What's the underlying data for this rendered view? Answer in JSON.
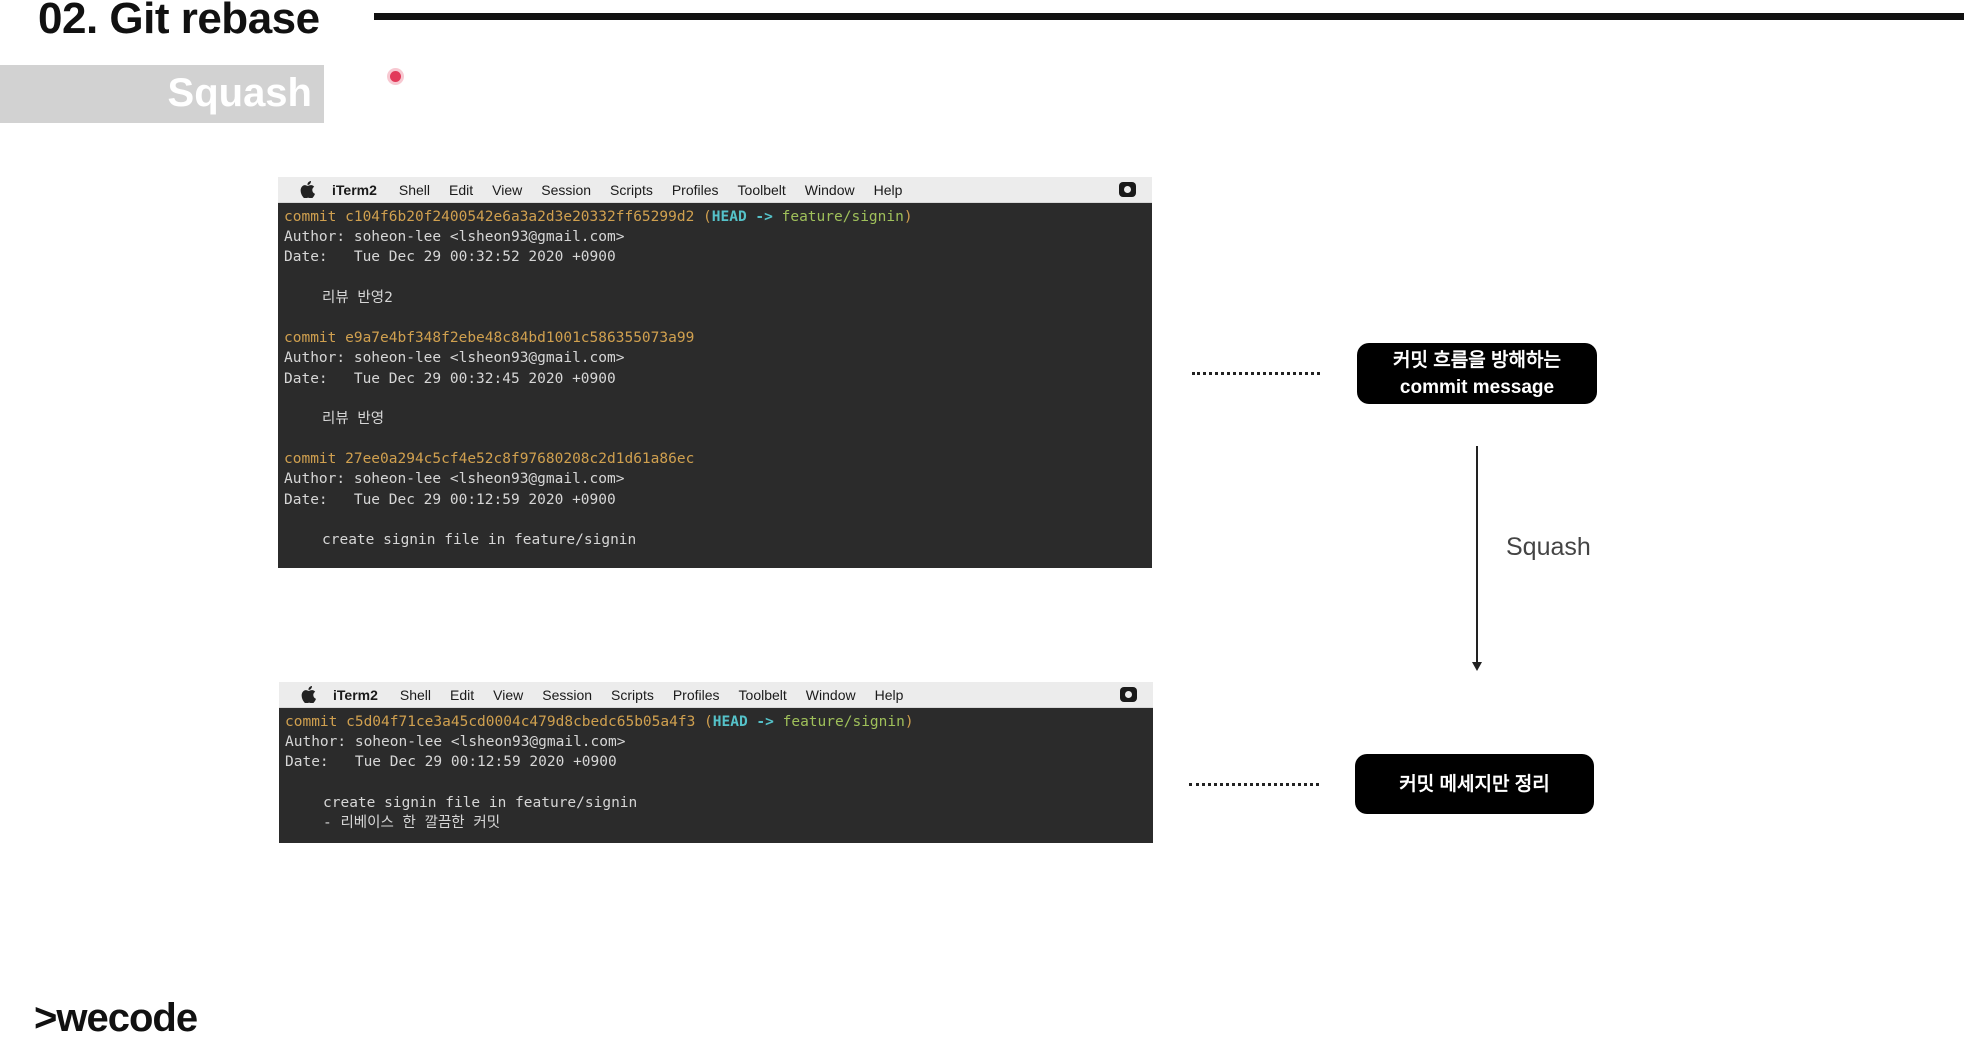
{
  "slide": {
    "title": "02. Git rebase",
    "section": "Squash"
  },
  "terminal_top": {
    "menubar": {
      "app": "iTerm2",
      "items": [
        "Shell",
        "Edit",
        "View",
        "Session",
        "Scripts",
        "Profiles",
        "Toolbelt",
        "Window",
        "Help"
      ]
    },
    "commits": [
      {
        "commit_prefix": "commit ",
        "hash": "c104f6b20f2400542e6a3a2d3e20332ff65299d2",
        "ref_open": " (",
        "head": "HEAD ->",
        "branch": " feature/signin",
        "ref_close": ")",
        "author": "Author: soheon-lee <lsheon93@gmail.com>",
        "date": "Date:   Tue Dec 29 00:32:52 2020 +0900",
        "message": "리뷰 반영2"
      },
      {
        "commit_prefix": "commit ",
        "hash": "e9a7e4bf348f2ebe48c84bd1001c586355073a99",
        "author": "Author: soheon-lee <lsheon93@gmail.com>",
        "date": "Date:   Tue Dec 29 00:32:45 2020 +0900",
        "message": "리뷰 반영"
      },
      {
        "commit_prefix": "commit ",
        "hash": "27ee0a294c5cf4e52c8f97680208c2d1d61a86ec",
        "author": "Author: soheon-lee <lsheon93@gmail.com>",
        "date": "Date:   Tue Dec 29 00:12:59 2020 +0900",
        "message": "create signin file in feature/signin"
      }
    ]
  },
  "terminal_bottom": {
    "menubar": {
      "app": "iTerm2",
      "items": [
        "Shell",
        "Edit",
        "View",
        "Session",
        "Scripts",
        "Profiles",
        "Toolbelt",
        "Window",
        "Help"
      ]
    },
    "commit": {
      "commit_prefix": "commit ",
      "hash": "c5d04f71ce3a45cd0004c479d8cbedc65b05a4f3",
      "ref_open": " (",
      "head": "HEAD ->",
      "branch": " feature/signin",
      "ref_close": ")",
      "author": "Author: soheon-lee <lsheon93@gmail.com>",
      "date": "Date:   Tue Dec 29 00:12:59 2020 +0900",
      "message_line1": "create signin file in feature/signin",
      "message_line2": "- 리베이스 한 깔끔한 커밋"
    }
  },
  "annotations": {
    "callout_top_line1": "커밋 흐름을 방해하는",
    "callout_top_line2": "commit message",
    "arrow_label": "Squash",
    "callout_bottom": "커밋 메세지만 정리"
  },
  "footer": {
    "logo": ">wecode"
  },
  "colors": {
    "terminal_bg": "#2b2b2b",
    "hash": "#d0a04f",
    "head": "#55c2c9",
    "branch": "#9fc05a",
    "callout_bg": "#000000",
    "section_tag_bg": "#d2d2d2"
  }
}
